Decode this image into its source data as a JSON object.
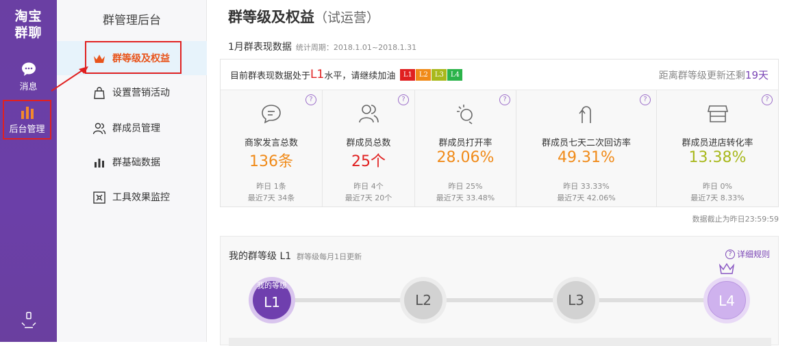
{
  "rail": {
    "brand_line1": "淘宝",
    "brand_line2": "群聊",
    "items": [
      {
        "label": "消息",
        "icon": "chat-bubble-icon"
      },
      {
        "label": "后台管理",
        "icon": "bar-chart-icon"
      }
    ]
  },
  "sidebar": {
    "title": "群管理后台",
    "items": [
      {
        "label": "群等级及权益",
        "icon": "crown-icon",
        "active": true
      },
      {
        "label": "设置营销活动",
        "icon": "shopping-bag-icon"
      },
      {
        "label": "群成员管理",
        "icon": "users-icon"
      },
      {
        "label": "群基础数据",
        "icon": "bar-chart-icon"
      },
      {
        "label": "工具效果监控",
        "icon": "monitor-icon"
      }
    ]
  },
  "main": {
    "title": "群等级及权益",
    "title_sub": "（试运营）",
    "section_title": "1月群表现数据",
    "period": "统计周期：2018.1.01~2018.1.31",
    "banner": {
      "prefix": "目前群表现数据处于",
      "level": "L1",
      "suffix": "水平，请继续加油",
      "badges": [
        {
          "label": "L1",
          "color": "#e02020"
        },
        {
          "label": "L2",
          "color": "#f08a18"
        },
        {
          "label": "L3",
          "color": "#a8b81c"
        },
        {
          "label": "L4",
          "color": "#2bb34a"
        }
      ],
      "countdown_prefix": "距离群等级更新还剩",
      "countdown_days": "19天"
    },
    "cards": [
      {
        "name": "商家发言总数",
        "value": "136条",
        "color": "#f08a18",
        "yesterday": "昨日 1条",
        "week": "最近7天 34条",
        "icon": "chat-icon"
      },
      {
        "name": "群成员总数",
        "value": "25个",
        "color": "#e02020",
        "yesterday": "昨日 4个",
        "week": "最近7天 20个",
        "icon": "users-icon"
      },
      {
        "name": "群成员打开率",
        "value": "28.06%",
        "color": "#f08a18",
        "yesterday": "昨日 25%",
        "week": "最近7天 33.48%",
        "icon": "tap-icon"
      },
      {
        "name": "群成员七天二次回访率",
        "value": "49.31%",
        "color": "#f08a18",
        "yesterday": "昨日 33.33%",
        "week": "最近7天 42.06%",
        "icon": "u-turn-icon"
      },
      {
        "name": "群成员进店转化率",
        "value": "13.38%",
        "color": "#a8b81c",
        "yesterday": "昨日 0%",
        "week": "最近7天 8.33%",
        "icon": "store-icon"
      }
    ],
    "deadline": "数据截止为昨日23:59:59",
    "level_section": {
      "title": "我的群等级 L1",
      "note": "群等级每月1日更新",
      "rules": "详细规则",
      "my_level_label": "我的等级",
      "nodes": [
        "L1",
        "L2",
        "L3",
        "L4"
      ]
    }
  }
}
